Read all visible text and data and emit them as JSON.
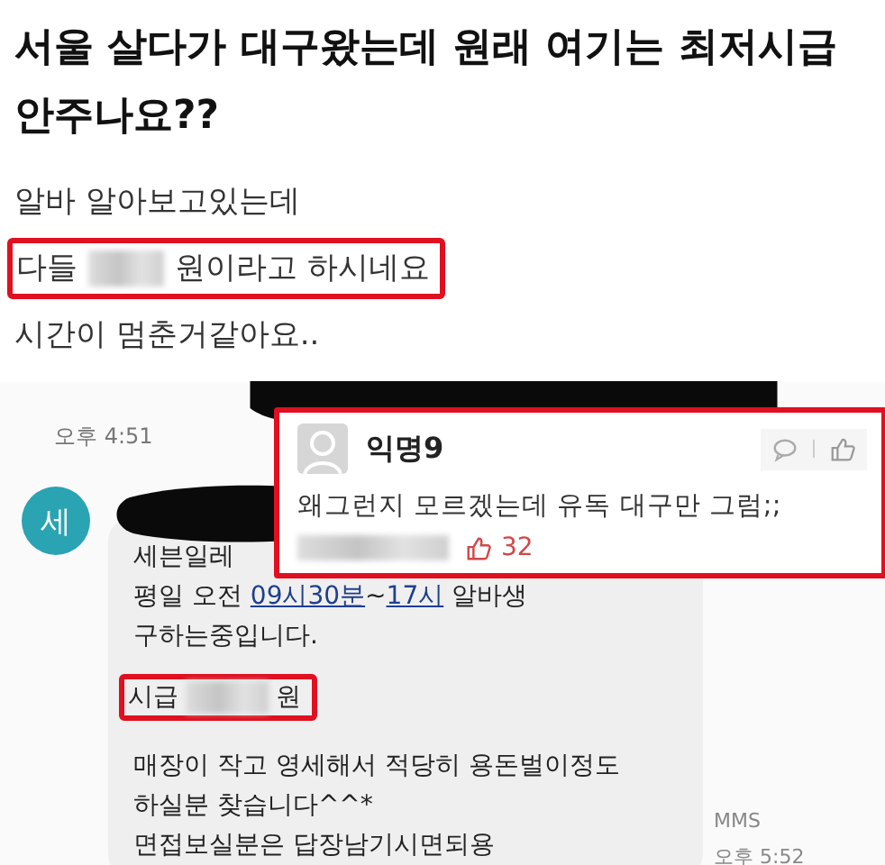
{
  "post": {
    "title": "서울 살다가 대구왔는데 원래 여기는 최저시급 안주나요??",
    "lines": [
      {
        "kind": "text",
        "text": "알바 알아보고있는데"
      },
      {
        "kind": "highlight",
        "before": "다들",
        "after": "원이라고 하시네요"
      },
      {
        "kind": "text",
        "text": "시간이 멈춘거같아요.."
      }
    ]
  },
  "message": {
    "time_received": "오후 4:51",
    "avatar": "세",
    "lines": [
      {
        "kind": "text",
        "text": "세븐일레"
      },
      {
        "kind": "segments",
        "segments": [
          {
            "text": "평일 오전 ",
            "link": false
          },
          {
            "text": "09시30분",
            "link": true
          },
          {
            "text": "~",
            "link": false
          },
          {
            "text": "17시",
            "link": true
          },
          {
            "text": " 알바생",
            "link": false
          }
        ]
      },
      {
        "kind": "text",
        "text": "구하는중입니다."
      },
      {
        "kind": "highlight",
        "before": "시급",
        "after": "원"
      },
      {
        "kind": "text",
        "text": "매장이 작고 영세해서 적당히 용돈벌이정도"
      },
      {
        "kind": "text",
        "text": "하실분 찾습니다^^*"
      },
      {
        "kind": "text",
        "text": "면접보실분은 답장남기시면되용"
      }
    ],
    "status": "MMS",
    "time_sent": "오후 5:52"
  },
  "comment": {
    "author": "익명9",
    "text": "왜그런지 모르겠는데 유독 대구만 그럼;;",
    "likes": "32"
  }
}
